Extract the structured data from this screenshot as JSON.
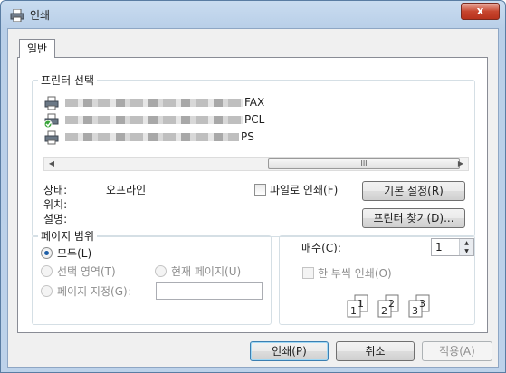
{
  "window": {
    "title": "인쇄",
    "close_label": "x"
  },
  "tabs": [
    {
      "label": "일반"
    }
  ],
  "printer_select": {
    "group_title": "프린터 선택",
    "printers": [
      {
        "suffix": "FAX"
      },
      {
        "suffix": "PCL"
      },
      {
        "suffix": "PS"
      }
    ],
    "scroll_thumb": "III",
    "status_label": "상태:",
    "status_value": "오프라인",
    "location_label": "위치:",
    "comment_label": "설명:",
    "print_to_file_label": "파일로 인쇄(F)",
    "preferences_button": "기본 설정(R)",
    "find_printer_button": "프린터 찾기(D)..."
  },
  "page_range": {
    "group_title": "페이지 범위",
    "all_label": "모두(L)",
    "selection_label": "선택 영역(T)",
    "current_page_label": "현재 페이지(U)",
    "pages_label": "페이지 지정(G):",
    "pages_value": ""
  },
  "copies": {
    "label": "매수(C):",
    "value": "1",
    "collate_label": "한 부씩 인쇄(O)",
    "collate_pages": [
      "1",
      "1",
      "2",
      "2",
      "3",
      "3"
    ]
  },
  "footer": {
    "print_button": "인쇄(P)",
    "cancel_button": "취소",
    "apply_button": "적용(A)"
  }
}
